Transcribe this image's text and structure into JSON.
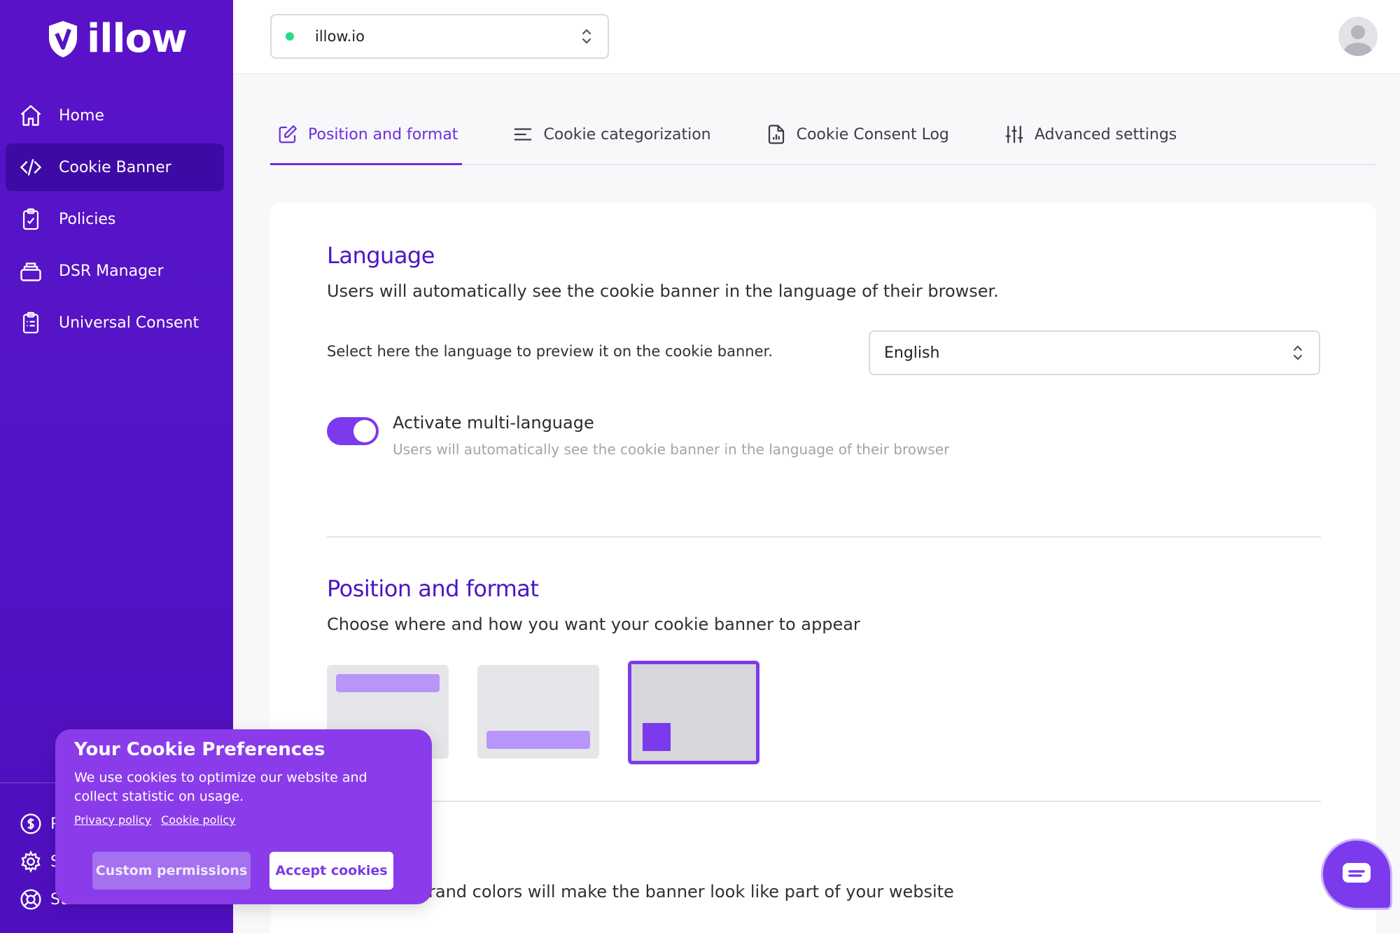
{
  "brand": {
    "name": "illow"
  },
  "sidebar": {
    "items": [
      {
        "label": "Home",
        "icon": "home-icon"
      },
      {
        "label": "Cookie Banner",
        "icon": "code-icon",
        "active": true
      },
      {
        "label": "Policies",
        "icon": "clipboard-check-icon"
      },
      {
        "label": "DSR Manager",
        "icon": "inbox-icon"
      },
      {
        "label": "Universal Consent",
        "icon": "clipboard-list-icon"
      }
    ],
    "bottom": [
      {
        "label": "P",
        "icon": "dollar-icon"
      },
      {
        "label": "S",
        "icon": "gear-icon"
      },
      {
        "label": "Su",
        "icon": "lifebuoy-icon"
      }
    ]
  },
  "topbar": {
    "site": "illow.io",
    "site_status_color": "#2dd88a"
  },
  "tabs": [
    {
      "label": "Position and format",
      "icon": "edit-icon",
      "active": true
    },
    {
      "label": "Cookie categorization",
      "icon": "list-icon"
    },
    {
      "label": "Cookie Consent Log",
      "icon": "document-chart-icon"
    },
    {
      "label": "Advanced settings",
      "icon": "sliders-icon"
    }
  ],
  "language": {
    "title": "Language",
    "subtitle": "Users will automatically see the cookie banner in the language of their browser.",
    "select_label": "Select here the language to preview it on the cookie banner.",
    "selected": "English",
    "multi_label": "Activate multi-language",
    "multi_help": "Users will automatically see the cookie banner in the language of their browser",
    "multi_enabled": true
  },
  "position": {
    "title": "Position and format",
    "subtitle": "Choose where and how you want your cookie banner to appear",
    "options": [
      "top-bar",
      "bottom-bar",
      "bottom-left-box"
    ],
    "selected": "bottom-left-box"
  },
  "colors_section": {
    "subtitle_partial": "rand colors will make the banner look like part of your website"
  },
  "cookie_popup": {
    "title": "Your Cookie Preferences",
    "text": "We use cookies to optimize our website and collect statistic on usage.",
    "privacy_link": "Privacy policy",
    "cookie_link": "Cookie policy",
    "custom_btn": "Custom permissions",
    "accept_btn": "Accept cookies"
  },
  "colors": {
    "accent": "#7c3aed",
    "sidebar": "#5514c6",
    "title": "#4c15c4"
  }
}
